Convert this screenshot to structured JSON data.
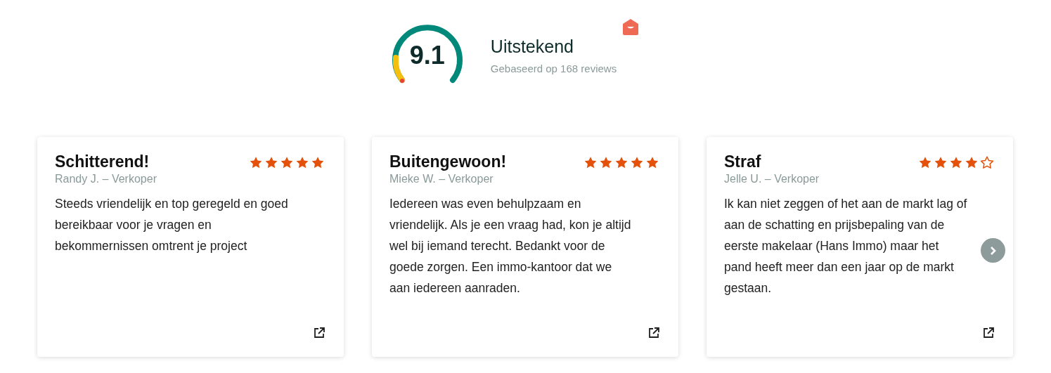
{
  "summary": {
    "score": "9.1",
    "label": "Uitstekend",
    "based_on": "Gebaseerd op 168 reviews"
  },
  "reviews": [
    {
      "title": "Schitterend!",
      "author": "Randy J. – Verkoper",
      "stars": 5,
      "text": "Steeds vriendelijk en top geregeld en goed bereikbaar voor je vragen en bekommernissen omtrent je project"
    },
    {
      "title": "Buitengewoon!",
      "author": "Mieke W. – Verkoper",
      "stars": 5,
      "text": "Iedereen was even behulpzaam en vriendelijk. Als je een vraag had, kon je altijd wel bij iemand terecht. Bedankt voor de goede zorgen. Een immo-kantoor dat we aan iedereen aanraden."
    },
    {
      "title": "Straf",
      "author": "Jelle U. – Verkoper",
      "stars": 4,
      "text": "Ik kan niet zeggen of het aan de markt lag of aan de schatting en prijsbepaling van de eerste makelaar (Hans Immo) maar het pand heeft meer dan een jaar op de markt gestaan."
    }
  ]
}
